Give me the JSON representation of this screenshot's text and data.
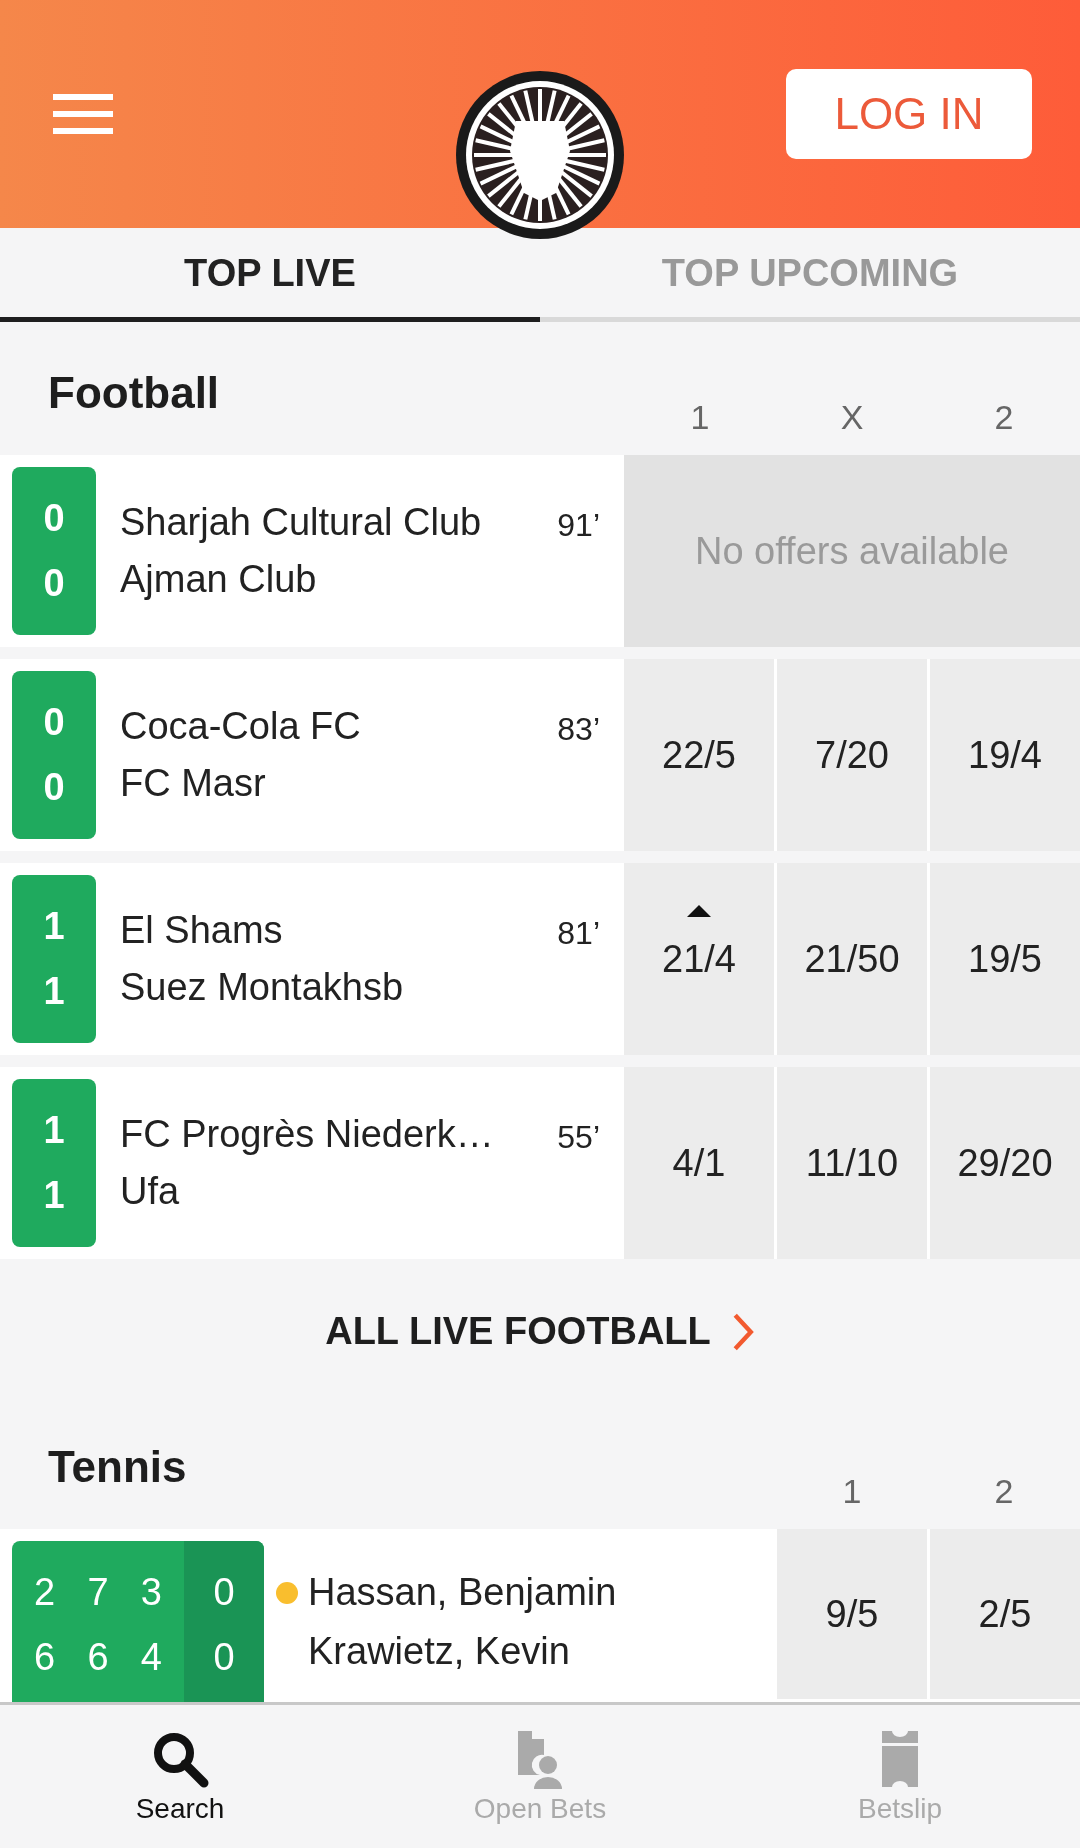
{
  "header": {
    "login_button": "LOG IN"
  },
  "tabs": [
    {
      "label": "TOP LIVE",
      "selected": true
    },
    {
      "label": "TOP UPCOMING",
      "selected": false
    }
  ],
  "football": {
    "title": "Football",
    "columns": [
      "1",
      "X",
      "2"
    ],
    "matches": [
      {
        "home_score": "0",
        "away_score": "0",
        "home": "Sharjah Cultural Club",
        "away": "Ajman Club",
        "minute": "91’",
        "no_offers": "No offers available"
      },
      {
        "home_score": "0",
        "away_score": "0",
        "home": "Coca-Cola FC",
        "away": "FC Masr",
        "minute": "83’",
        "odds": [
          {
            "value": "22/5",
            "rising": false
          },
          {
            "value": "7/20",
            "rising": false
          },
          {
            "value": "19/4",
            "rising": false
          }
        ]
      },
      {
        "home_score": "1",
        "away_score": "1",
        "home": "El Shams",
        "away": "Suez Montakhsb",
        "minute": "81’",
        "odds": [
          {
            "value": "21/4",
            "rising": true
          },
          {
            "value": "21/50",
            "rising": false
          },
          {
            "value": "19/5",
            "rising": false
          }
        ]
      },
      {
        "home_score": "1",
        "away_score": "1",
        "home": "FC Progrès Niederk…",
        "away": "Ufa",
        "minute": "55’",
        "odds": [
          {
            "value": "4/1",
            "rising": false
          },
          {
            "value": "11/10",
            "rising": false
          },
          {
            "value": "29/20",
            "rising": false
          }
        ]
      }
    ],
    "all_link": "ALL LIVE FOOTBALL"
  },
  "tennis": {
    "title": "Tennis",
    "columns": [
      "1",
      "2"
    ],
    "matches": [
      {
        "players": [
          {
            "name": "Hassan, Benjamin",
            "serving": true,
            "sets": [
              "2",
              "7",
              "3"
            ],
            "points": "0"
          },
          {
            "name": "Krawietz, Kevin",
            "serving": false,
            "sets": [
              "6",
              "6",
              "4"
            ],
            "points": "0"
          }
        ],
        "odds": [
          "9/5",
          "2/5"
        ]
      }
    ]
  },
  "nav": [
    {
      "label": "Search",
      "selected": true
    },
    {
      "label": "Open Bets",
      "selected": false
    },
    {
      "label": "Betslip",
      "selected": false
    }
  ]
}
